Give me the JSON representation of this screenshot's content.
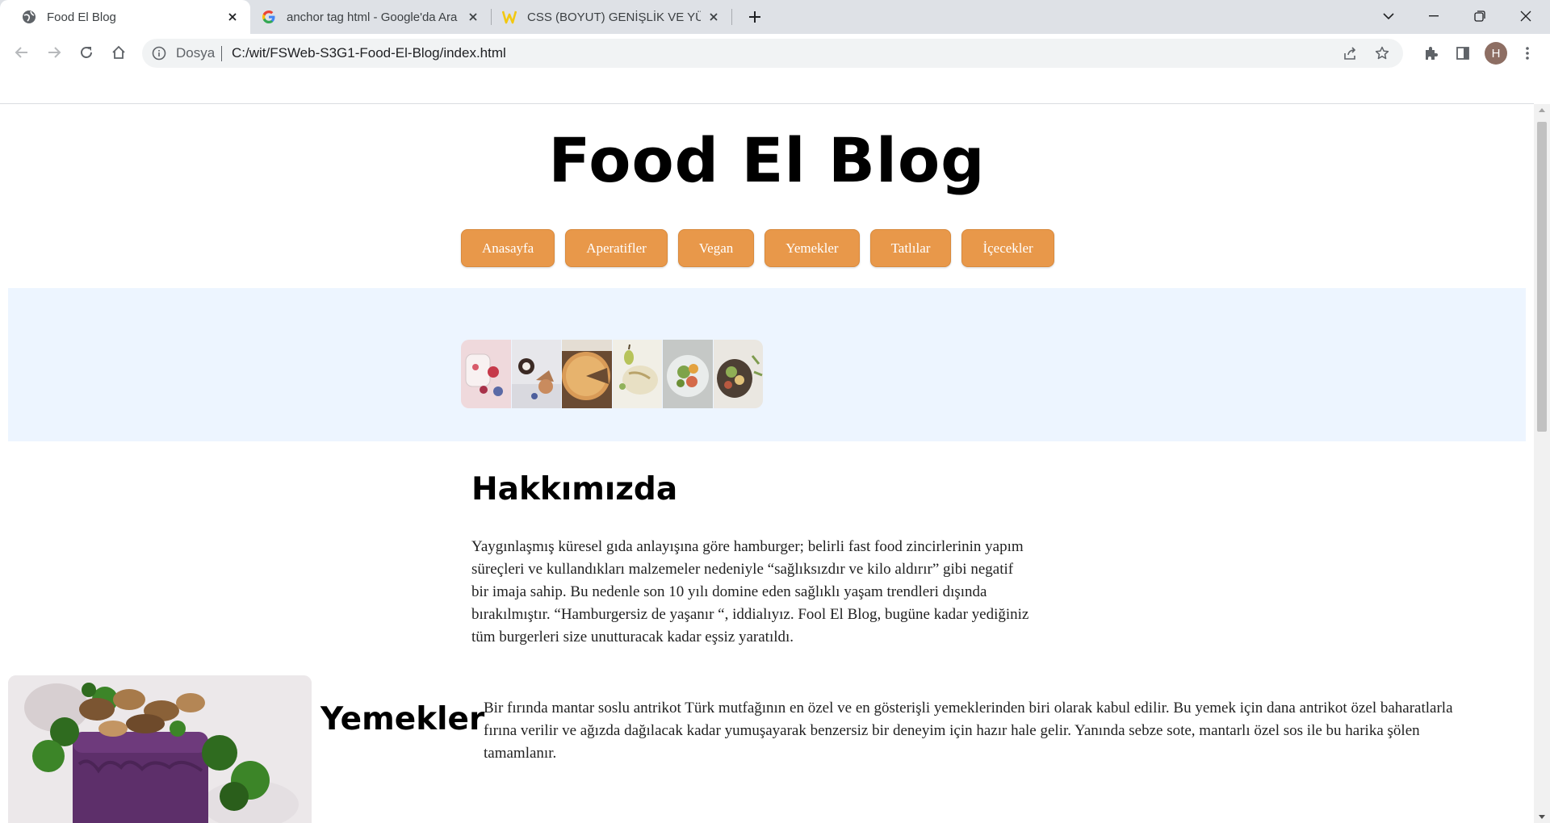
{
  "browser": {
    "tabs": [
      {
        "title": "Food El Blog",
        "active": true,
        "icon": "globe-icon"
      },
      {
        "title": "anchor tag html - Google'da Ara",
        "active": false,
        "icon": "google-icon"
      },
      {
        "title": "CSS (BOYUT) GENİŞLİK VE YÜKSE",
        "active": false,
        "icon": "w3-icon"
      }
    ],
    "address": {
      "scheme_label": "Dosya",
      "url": "C:/wit/FSWeb-S3G1-Food-El-Blog/index.html"
    },
    "profile_initial": "H"
  },
  "site": {
    "title": "Food El Blog",
    "menu": [
      "Anasayfa",
      "Aperatifler",
      "Vegan",
      "Yemekler",
      "Tatlılar",
      "İçecekler"
    ],
    "accent_color": "#e8984a",
    "hero_bg": "#edf5ff"
  },
  "about": {
    "heading": "Hakkımızda",
    "lines": [
      "Yaygınlaşmış küresel gıda anlayışına göre hamburger; belirli fast food zincirlerinin yapım",
      "süreçleri ve kullandıkları malzemeler nedeniyle “sağlıksızdır ve kilo aldırır” gibi negatif",
      "bir imaja sahip. Bu nedenle son 10 yılı domine eden sağlıklı yaşam trendleri dışında",
      "bırakılmıştır. “Hamburgersiz de yaşanır “, iddialıyız. Fool El Blog, bugüne kadar yediğiniz",
      "tüm burgerleri size unutturacak kadar eşsiz yaratıldı."
    ]
  },
  "dishes": {
    "heading": "Yemekler",
    "lines": [
      "Bir fırında mantar soslu antrikot Türk mutfağının en özel ve en gösterişli yemeklerinden biri olarak kabul edilir. Bu yemek için dana antrikot özel baharatlarla",
      "fırına verilir ve ağızda dağılacak kadar yumuşayarak benzersiz bir deneyim için hazır hale gelir. Yanında sebze sote, mantarlı özel sos ile bu harika şölen",
      "tamamlanır."
    ]
  }
}
